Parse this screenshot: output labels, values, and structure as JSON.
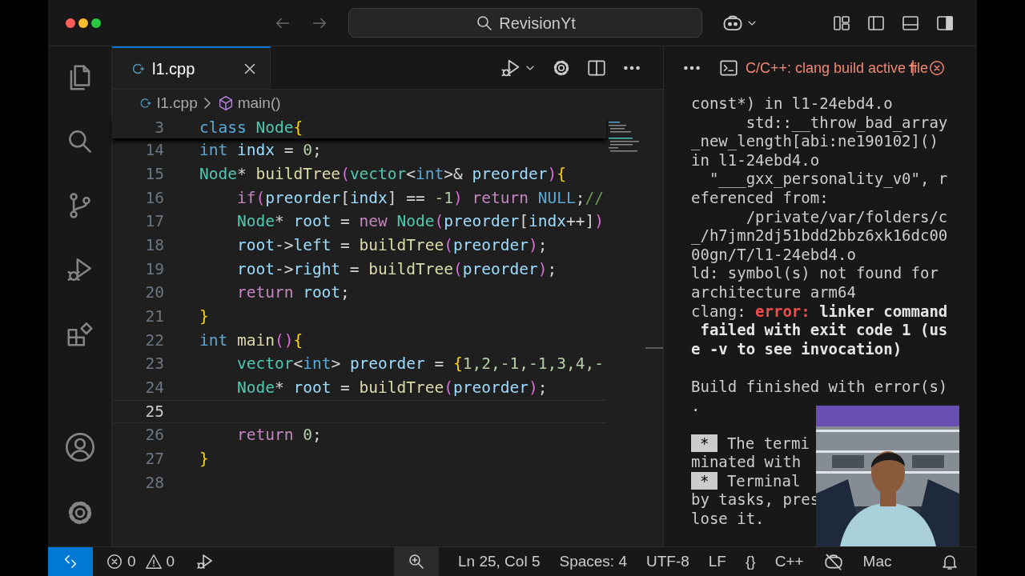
{
  "title_bar": {
    "search": {
      "label": "RevisionYt"
    },
    "actions": [
      {
        "kind": "layout"
      },
      {
        "kind": "sidebar_left"
      },
      {
        "kind": "panel"
      },
      {
        "kind": "sidebar_right"
      }
    ]
  },
  "activity_bar": {
    "top": [
      {
        "kind": "explorer"
      },
      {
        "kind": "search"
      },
      {
        "kind": "source_control"
      },
      {
        "kind": "run_debug"
      },
      {
        "kind": "extensions"
      }
    ],
    "bottom": [
      {
        "kind": "account"
      },
      {
        "kind": "settings"
      }
    ]
  },
  "editor": {
    "tabs": [
      {
        "label": "l1.cpp",
        "selected": true
      }
    ],
    "breadcrumbs": [
      {
        "kind": "file",
        "label": "l1.cpp"
      },
      {
        "kind": "symbol",
        "label": "main()"
      }
    ],
    "sticky_line": {
      "number": "3",
      "tokens": [
        {
          "kind": "kw",
          "text": "class "
        },
        {
          "kind": "type",
          "text": "Node"
        },
        {
          "kind": "brace",
          "text": "{"
        }
      ]
    },
    "lines": [
      {
        "number": "14",
        "current": false,
        "tokens": [
          {
            "kind": "kw",
            "text": "int "
          },
          {
            "kind": "var",
            "text": "indx"
          },
          {
            "kind": "plain",
            "text": " = "
          },
          {
            "kind": "num",
            "text": "0"
          },
          {
            "kind": "plain",
            "text": ";"
          }
        ]
      },
      {
        "number": "15",
        "current": false,
        "tokens": [
          {
            "kind": "type",
            "text": "Node"
          },
          {
            "kind": "plain",
            "text": "* "
          },
          {
            "kind": "fn",
            "text": "buildTree"
          },
          {
            "kind": "paren",
            "text": "("
          },
          {
            "kind": "type",
            "text": "vector"
          },
          {
            "kind": "plain",
            "text": "<"
          },
          {
            "kind": "kw",
            "text": "int"
          },
          {
            "kind": "plain",
            "text": ">& "
          },
          {
            "kind": "var",
            "text": "preorder"
          },
          {
            "kind": "paren",
            "text": ")"
          },
          {
            "kind": "brace",
            "text": "{"
          }
        ]
      },
      {
        "number": "16",
        "current": false,
        "tokens": [
          {
            "kind": "ctrl",
            "text": "    if"
          },
          {
            "kind": "paren",
            "text": "("
          },
          {
            "kind": "var",
            "text": "preorder"
          },
          {
            "kind": "plain",
            "text": "["
          },
          {
            "kind": "var",
            "text": "indx"
          },
          {
            "kind": "plain",
            "text": "] == "
          },
          {
            "kind": "num",
            "text": "-1"
          },
          {
            "kind": "paren",
            "text": ")"
          },
          {
            "kind": "ctrl",
            "text": " return "
          },
          {
            "kind": "kw",
            "text": "NULL"
          },
          {
            "kind": "plain",
            "text": ";"
          },
          {
            "kind": "comment",
            "text": "//"
          }
        ]
      },
      {
        "number": "17",
        "current": false,
        "tokens": [
          {
            "kind": "type",
            "text": "    Node"
          },
          {
            "kind": "plain",
            "text": "* "
          },
          {
            "kind": "var",
            "text": "root"
          },
          {
            "kind": "plain",
            "text": " = "
          },
          {
            "kind": "ctrl",
            "text": "new "
          },
          {
            "kind": "type",
            "text": "Node"
          },
          {
            "kind": "paren",
            "text": "("
          },
          {
            "kind": "var",
            "text": "preorder"
          },
          {
            "kind": "plain",
            "text": "["
          },
          {
            "kind": "var",
            "text": "indx"
          },
          {
            "kind": "plain",
            "text": "++]"
          },
          {
            "kind": "paren",
            "text": ")"
          }
        ]
      },
      {
        "number": "18",
        "current": false,
        "tokens": [
          {
            "kind": "var",
            "text": "    root"
          },
          {
            "kind": "plain",
            "text": "->"
          },
          {
            "kind": "var",
            "text": "left"
          },
          {
            "kind": "plain",
            "text": " = "
          },
          {
            "kind": "fn",
            "text": "buildTree"
          },
          {
            "kind": "paren",
            "text": "("
          },
          {
            "kind": "var",
            "text": "preorder"
          },
          {
            "kind": "paren",
            "text": ")"
          },
          {
            "kind": "plain",
            "text": ";"
          }
        ]
      },
      {
        "number": "19",
        "current": false,
        "tokens": [
          {
            "kind": "var",
            "text": "    root"
          },
          {
            "kind": "plain",
            "text": "->"
          },
          {
            "kind": "var",
            "text": "right"
          },
          {
            "kind": "plain",
            "text": " = "
          },
          {
            "kind": "fn",
            "text": "buildTree"
          },
          {
            "kind": "paren",
            "text": "("
          },
          {
            "kind": "var",
            "text": "preorder"
          },
          {
            "kind": "paren",
            "text": ")"
          },
          {
            "kind": "plain",
            "text": ";"
          }
        ]
      },
      {
        "number": "20",
        "current": false,
        "tokens": [
          {
            "kind": "ctrl",
            "text": "    return "
          },
          {
            "kind": "var",
            "text": "root"
          },
          {
            "kind": "plain",
            "text": ";"
          }
        ]
      },
      {
        "number": "21",
        "current": false,
        "tokens": [
          {
            "kind": "brace",
            "text": "}"
          }
        ]
      },
      {
        "number": "22",
        "current": false,
        "tokens": [
          {
            "kind": "kw",
            "text": "int "
          },
          {
            "kind": "fn",
            "text": "main"
          },
          {
            "kind": "paren",
            "text": "()"
          },
          {
            "kind": "brace",
            "text": "{"
          }
        ]
      },
      {
        "number": "23",
        "current": false,
        "tokens": [
          {
            "kind": "type",
            "text": "    vector"
          },
          {
            "kind": "plain",
            "text": "<"
          },
          {
            "kind": "kw",
            "text": "int"
          },
          {
            "kind": "plain",
            "text": "> "
          },
          {
            "kind": "var",
            "text": "preorder"
          },
          {
            "kind": "plain",
            "text": " = "
          },
          {
            "kind": "brace",
            "text": "{"
          },
          {
            "kind": "num",
            "text": "1,2,-1,-1,3,4,-"
          }
        ]
      },
      {
        "number": "24",
        "current": false,
        "tokens": [
          {
            "kind": "type",
            "text": "    Node"
          },
          {
            "kind": "plain",
            "text": "* "
          },
          {
            "kind": "var",
            "text": "root"
          },
          {
            "kind": "plain",
            "text": " = "
          },
          {
            "kind": "fn",
            "text": "buildTree"
          },
          {
            "kind": "paren",
            "text": "("
          },
          {
            "kind": "var",
            "text": "preorder"
          },
          {
            "kind": "paren",
            "text": ")"
          },
          {
            "kind": "plain",
            "text": ";"
          }
        ]
      },
      {
        "number": "25",
        "current": true
      },
      {
        "number": "26",
        "current": false,
        "tokens": [
          {
            "kind": "ctrl",
            "text": "    return "
          },
          {
            "kind": "num",
            "text": "0"
          },
          {
            "kind": "plain",
            "text": ";"
          }
        ]
      },
      {
        "number": "27",
        "current": false,
        "tokens": [
          {
            "kind": "brace",
            "text": "}"
          }
        ]
      },
      {
        "number": "28",
        "current": false
      }
    ]
  },
  "panel": {
    "title": "C/C++: clang build active file",
    "terminal_lines": [
      {
        "kind": "text",
        "segments": [
          {
            "kind": "normal",
            "text": "const*) in l1-24ebd4.o"
          }
        ]
      },
      {
        "kind": "text",
        "segments": [
          {
            "kind": "normal",
            "text": "      std::__throw_bad_array"
          }
        ]
      },
      {
        "kind": "text",
        "segments": [
          {
            "kind": "normal",
            "text": "_new_length[abi:ne190102]()"
          }
        ]
      },
      {
        "kind": "text",
        "segments": [
          {
            "kind": "normal",
            "text": "in l1-24ebd4.o"
          }
        ]
      },
      {
        "kind": "text",
        "segments": [
          {
            "kind": "normal",
            "text": "  \"___gxx_personality_v0\", r"
          }
        ]
      },
      {
        "kind": "text",
        "segments": [
          {
            "kind": "normal",
            "text": "eferenced from:"
          }
        ]
      },
      {
        "kind": "text",
        "segments": [
          {
            "kind": "normal",
            "text": "      /private/var/folders/c"
          }
        ]
      },
      {
        "kind": "text",
        "segments": [
          {
            "kind": "normal",
            "text": "_/h7jmn2dj51bdd2bbz6xk16dc00"
          }
        ]
      },
      {
        "kind": "text",
        "segments": [
          {
            "kind": "normal",
            "text": "00gn/T/l1-24ebd4.o"
          }
        ]
      },
      {
        "kind": "text",
        "segments": [
          {
            "kind": "normal",
            "text": "ld: symbol(s) not found for"
          }
        ]
      },
      {
        "kind": "text",
        "segments": [
          {
            "kind": "normal",
            "text": "architecture arm64"
          }
        ]
      },
      {
        "kind": "text",
        "segments": [
          {
            "kind": "normal",
            "text": "clang: "
          },
          {
            "kind": "error",
            "text": "error:"
          },
          {
            "kind": "bold",
            "text": " linker command"
          }
        ]
      },
      {
        "kind": "text",
        "segments": [
          {
            "kind": "bold",
            "text": " failed with exit code 1 (us"
          }
        ]
      },
      {
        "kind": "text",
        "segments": [
          {
            "kind": "bold",
            "text": "e -v to see invocation)"
          }
        ]
      },
      {
        "kind": "blank"
      },
      {
        "kind": "text",
        "segments": [
          {
            "kind": "normal",
            "text": "Build finished with error(s)"
          }
        ]
      },
      {
        "kind": "text",
        "segments": [
          {
            "kind": "normal",
            "text": "."
          }
        ]
      },
      {
        "kind": "blank"
      },
      {
        "kind": "text",
        "segments": [
          {
            "kind": "badge",
            "text": "*"
          },
          {
            "kind": "normal",
            "text": " The termi"
          }
        ]
      },
      {
        "kind": "text",
        "segments": [
          {
            "kind": "normal",
            "text": "minated with"
          }
        ]
      },
      {
        "kind": "text",
        "segments": [
          {
            "kind": "badge",
            "text": "*"
          },
          {
            "kind": "normal",
            "text": " Terminal"
          }
        ]
      },
      {
        "kind": "text",
        "segments": [
          {
            "kind": "normal",
            "text": "by tasks, pres"
          }
        ]
      },
      {
        "kind": "text",
        "segments": [
          {
            "kind": "normal",
            "text": "lose it."
          }
        ]
      }
    ]
  },
  "status_bar": {
    "left": [
      {
        "kind": "remote"
      },
      {
        "kind": "problems",
        "errors": "0",
        "warnings": "0"
      },
      {
        "kind": "debug"
      }
    ],
    "right": [
      {
        "kind": "zoom"
      },
      {
        "kind": "text",
        "text": "Ln 25, Col 5"
      },
      {
        "kind": "text",
        "text": "Spaces: 4"
      },
      {
        "kind": "text",
        "text": "UTF-8"
      },
      {
        "kind": "text",
        "text": "LF"
      },
      {
        "kind": "text",
        "text": "{}"
      },
      {
        "kind": "text",
        "text": "C++"
      },
      {
        "kind": "copilot_off"
      },
      {
        "kind": "text",
        "text": "Mac"
      },
      {
        "kind": "bell"
      }
    ]
  }
}
